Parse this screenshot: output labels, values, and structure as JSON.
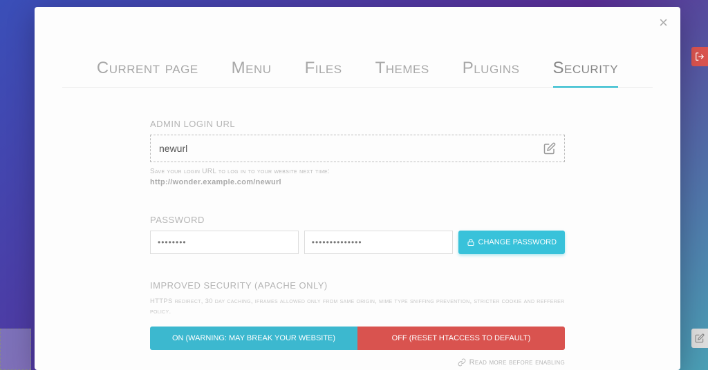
{
  "tabs": {
    "current_page": "Current page",
    "menu": "Menu",
    "files": "Files",
    "themes": "Themes",
    "plugins": "Plugins",
    "security": "Security"
  },
  "admin_url": {
    "label": "ADMIN LOGIN URL",
    "value": "newurl",
    "hint_prefix": "Save your login URL to log in to your website next time:",
    "hint_url": "http://wonder.example.com/newurl"
  },
  "password": {
    "label": "PASSWORD",
    "field1": "••••••••",
    "field2": "••••••••••••••",
    "button": "CHANGE PASSWORD"
  },
  "improved": {
    "label": "IMPROVED SECURITY (APACHE ONLY)",
    "desc": "HTTPS redirect, 30 day caching, iframes allowed only from same origin, mime type sniffing prevention, stricter cookie and refferer policy.",
    "on": "ON (WARNING: MAY BREAK YOUR WEBSITE)",
    "off": "OFF (RESET HTACCESS TO DEFAULT)",
    "readmore": "Read more before enabling"
  }
}
